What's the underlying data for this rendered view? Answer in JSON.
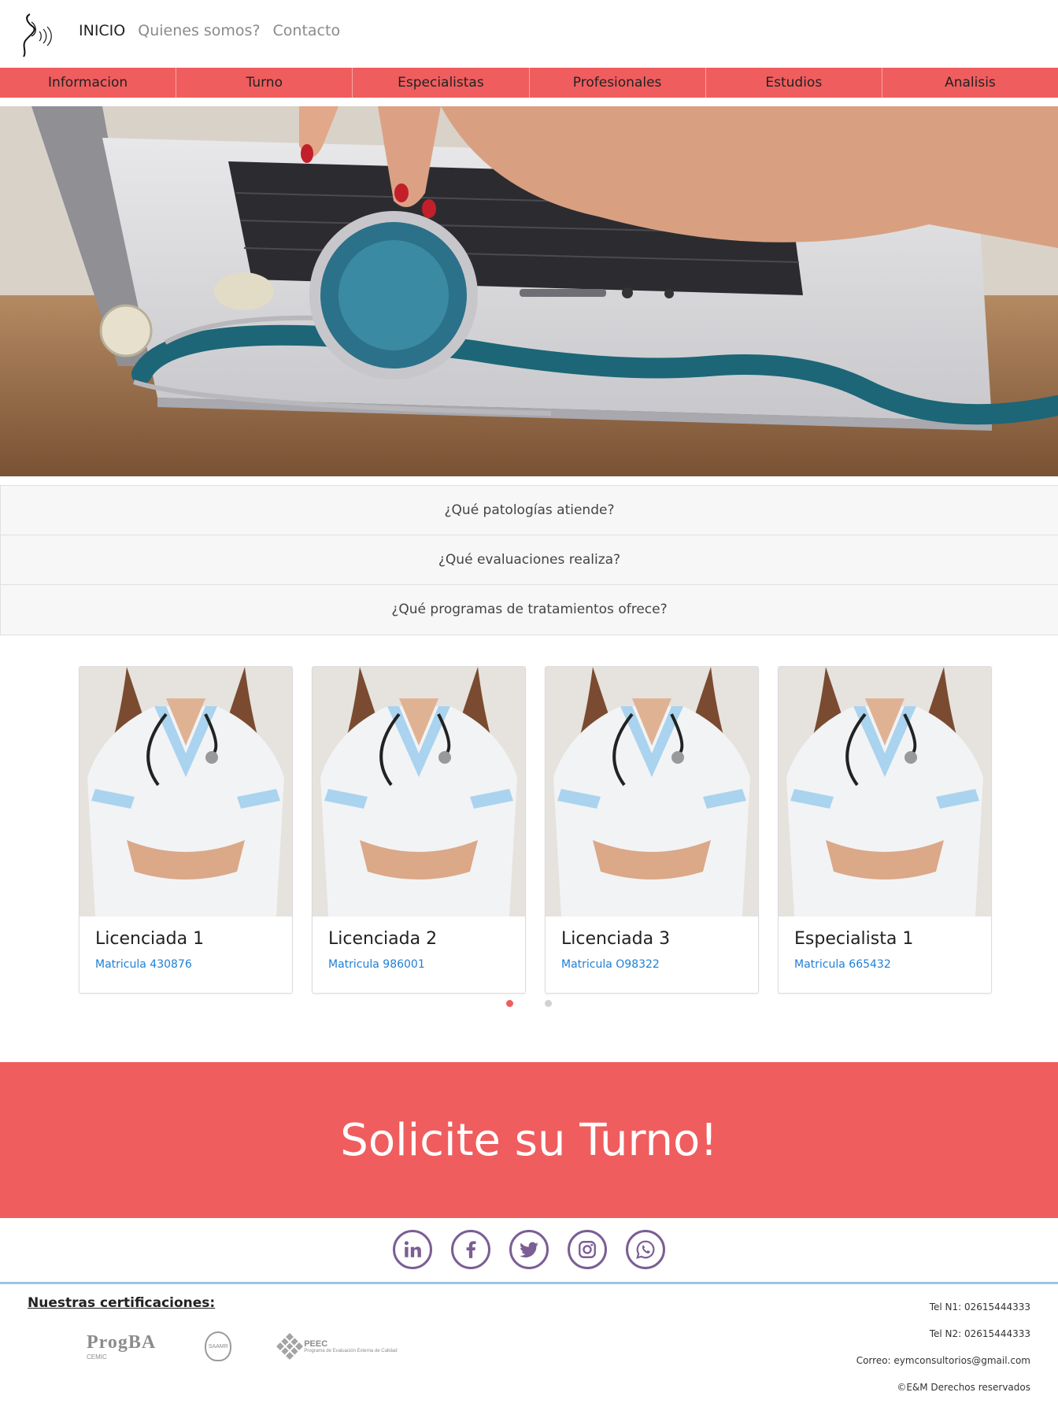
{
  "topnav": {
    "items": [
      "INICIO",
      "Quienes somos?",
      "Contacto"
    ]
  },
  "categories": [
    "Informacion",
    "Turno",
    "Especialistas",
    "Profesionales",
    "Estudios",
    "Analisis"
  ],
  "accordion": [
    "¿Qué patologías atiende?",
    "¿Qué evaluaciones realiza?",
    "¿Qué programas de tratamientos ofrece?"
  ],
  "cards": [
    {
      "title": "Licenciada 1",
      "subtitle": "Matricula 430876"
    },
    {
      "title": "Licenciada 2",
      "subtitle": "Matricula 986001"
    },
    {
      "title": "Licenciada 3",
      "subtitle": "Matricula O98322"
    },
    {
      "title": "Especialista 1",
      "subtitle": "Matricula 665432"
    }
  ],
  "carousel": {
    "active_index": 0,
    "count": 2
  },
  "cta": {
    "label": "Solicite su Turno!"
  },
  "social": [
    "linkedin-icon",
    "facebook-icon",
    "twitter-icon",
    "instagram-icon",
    "whatsapp-icon"
  ],
  "footer": {
    "cert_title": "Nuestras certificaciones:",
    "certs": {
      "progba": "ProgBA",
      "progba_sub": "CEMIC",
      "seal": "SAAMR",
      "peec": "PEEC",
      "peec_sub": "Programa de Evaluación Externa de Calidad"
    },
    "tel1": "Tel N1: 02615444333",
    "tel2": "Tel N2: 02615444333",
    "email": "Correo: eymconsultorios@gmail.com",
    "copyright": "©E&M Derechos reservados"
  },
  "colors": {
    "accent": "#f05d5e",
    "social": "#7b5e94",
    "link": "#1e7fd6",
    "footer_border": "#9ec3e6"
  }
}
